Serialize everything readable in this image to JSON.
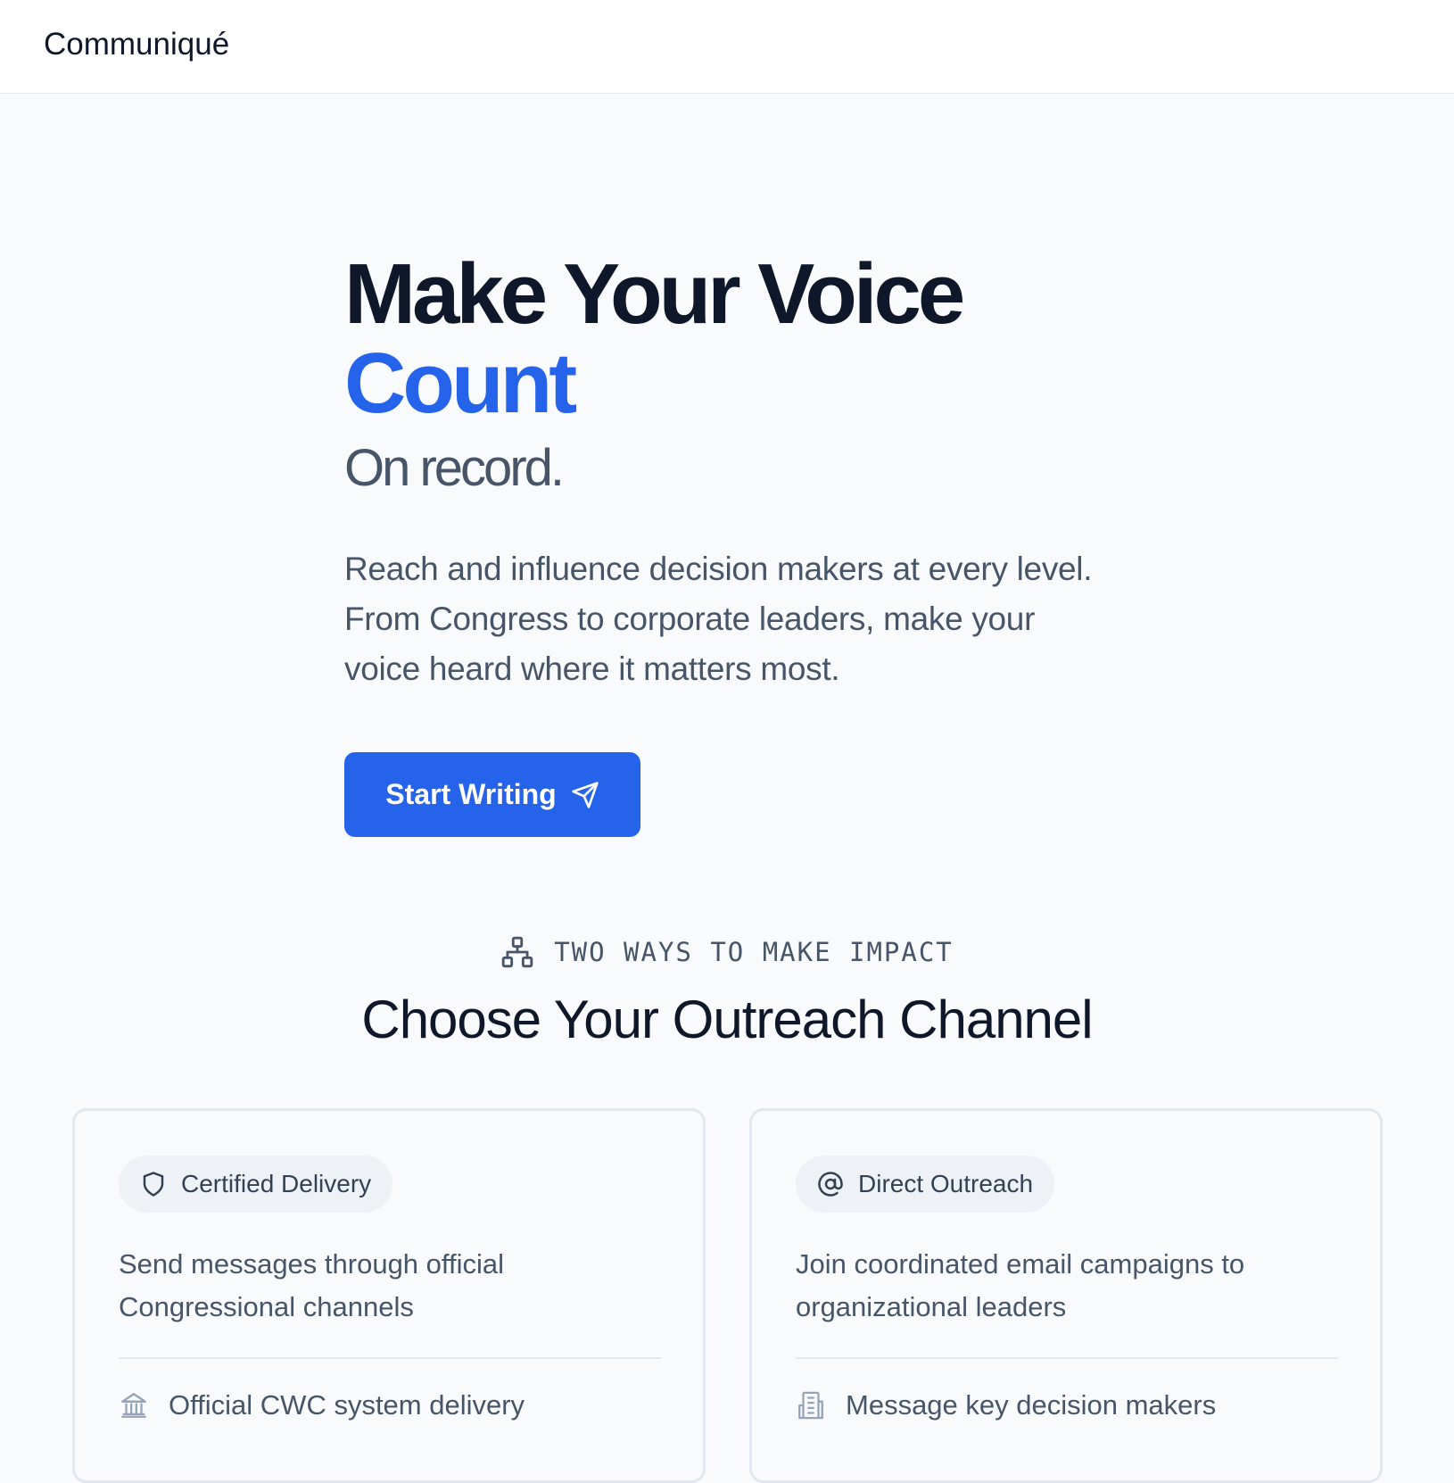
{
  "header": {
    "brand": "Communiqué"
  },
  "hero": {
    "line1": "Make Your Voice",
    "line2": "Count",
    "subtitle": "On record.",
    "description": "Reach and influence decision makers at every level. From Congress to corporate leaders, make your voice heard where it matters most.",
    "cta_label": "Start Writing",
    "cta_icon": "send-icon"
  },
  "section": {
    "tag_icon": "network-icon",
    "tag": "TWO WAYS TO MAKE IMPACT",
    "title": "Choose Your Outreach Channel"
  },
  "cards": [
    {
      "pill_icon": "shield-icon",
      "pill_label": "Certified Delivery",
      "description": "Send messages through official Congressional channels",
      "feature_icon": "landmark-icon",
      "feature": "Official CWC system delivery"
    },
    {
      "pill_icon": "at-sign-icon",
      "pill_label": "Direct Outreach",
      "description": "Join coordinated email campaigns to organizational leaders",
      "feature_icon": "building-icon",
      "feature": "Message key decision makers"
    }
  ],
  "colors": {
    "accent": "#2563eb",
    "heading": "#0f172a",
    "muted": "#475569",
    "background": "#f8fafc",
    "border": "#e2e8f0"
  }
}
